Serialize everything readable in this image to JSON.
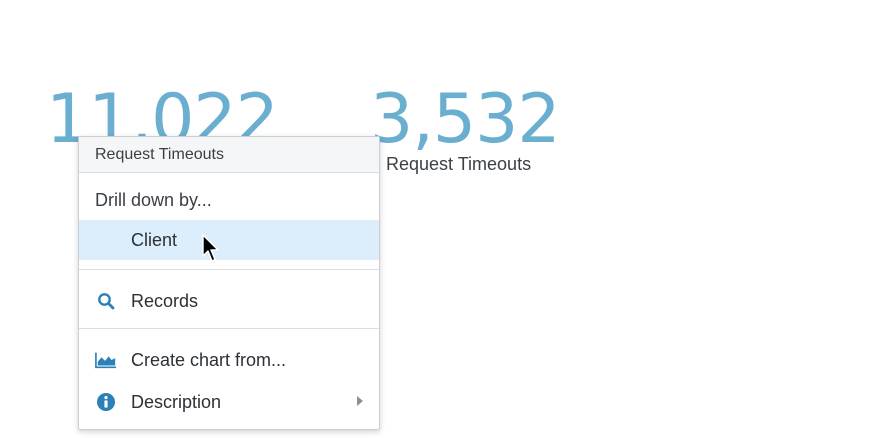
{
  "metrics": [
    {
      "value": "11,022",
      "label": "Request Timeouts"
    },
    {
      "value": "3,532",
      "label": "Request Timeouts"
    }
  ],
  "context_menu": {
    "header": "Request Timeouts",
    "drill_label": "Drill down by...",
    "items": {
      "client": "Client",
      "records": "Records",
      "create_chart": "Create chart from...",
      "description": "Description"
    },
    "icons": {
      "records": "search-icon",
      "create_chart": "area-chart-icon",
      "description": "info-icon"
    },
    "highlighted_item": "client"
  },
  "colors": {
    "metric_value": "#6aaed0",
    "menu_highlight": "#dceefb",
    "icon_blue": "#2d7fb8"
  }
}
